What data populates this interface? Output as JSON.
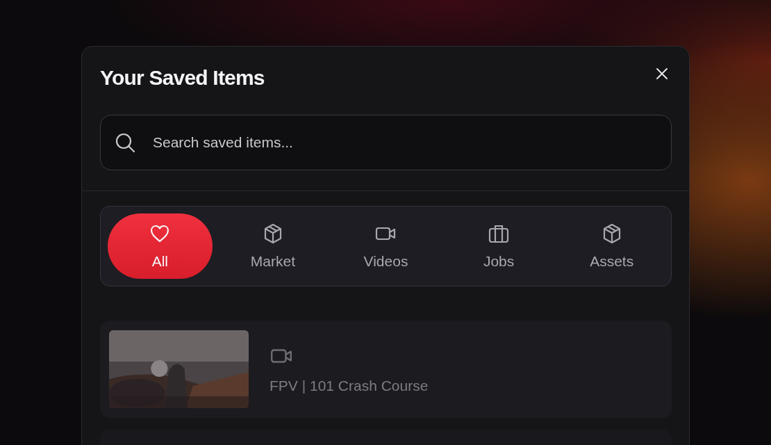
{
  "dialog": {
    "title": "Your Saved Items",
    "search": {
      "placeholder": "Search saved items..."
    },
    "tabs": [
      {
        "label": "All",
        "kind": "heart",
        "selected": true
      },
      {
        "label": "Market",
        "kind": "box",
        "selected": false
      },
      {
        "label": "Videos",
        "kind": "video",
        "selected": false
      },
      {
        "label": "Jobs",
        "kind": "briefcase",
        "selected": false
      },
      {
        "label": "Assets",
        "kind": "box",
        "selected": false
      }
    ],
    "items": [
      {
        "kind": "video",
        "title": "FPV | 101 Crash Course"
      }
    ]
  }
}
